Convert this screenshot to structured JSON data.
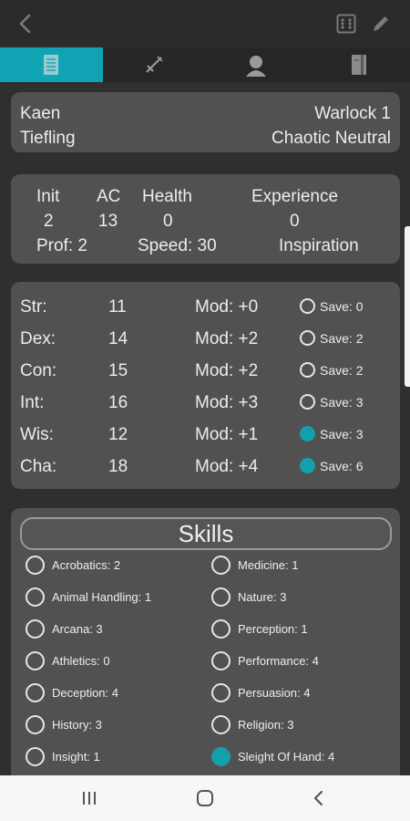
{
  "character": {
    "name": "Kaen",
    "race": "Tiefling",
    "class_level": "Warlock  1",
    "alignment": "Chaotic Neutral"
  },
  "combat": {
    "init_label": "Init",
    "init_value": "2",
    "ac_label": "AC",
    "ac_value": "13",
    "health_label": "Health",
    "health_value": "0",
    "experience_label": "Experience",
    "experience_value": "0",
    "prof": "Prof: 2",
    "speed": "Speed: 30",
    "inspiration": "Inspiration"
  },
  "abilities": [
    {
      "name": "Str:",
      "score": "11",
      "mod": "Mod: +0",
      "save": "Save: 0",
      "proficient": false
    },
    {
      "name": "Dex:",
      "score": "14",
      "mod": "Mod: +2",
      "save": "Save: 2",
      "proficient": false
    },
    {
      "name": "Con:",
      "score": "15",
      "mod": "Mod: +2",
      "save": "Save: 2",
      "proficient": false
    },
    {
      "name": "Int:",
      "score": "16",
      "mod": "Mod: +3",
      "save": "Save: 3",
      "proficient": false
    },
    {
      "name": "Wis:",
      "score": "12",
      "mod": "Mod: +1",
      "save": "Save: 3",
      "proficient": true
    },
    {
      "name": "Cha:",
      "score": "18",
      "mod": "Mod: +4",
      "save": "Save: 6",
      "proficient": true
    }
  ],
  "skills": {
    "title": "Skills",
    "left": [
      {
        "label": "Acrobatics: 2",
        "proficient": false
      },
      {
        "label": "Animal Handling: 1",
        "proficient": false
      },
      {
        "label": "Arcana: 3",
        "proficient": false
      },
      {
        "label": "Athletics: 0",
        "proficient": false
      },
      {
        "label": "Deception: 4",
        "proficient": false
      },
      {
        "label": "History: 3",
        "proficient": false
      },
      {
        "label": "Insight: 1",
        "proficient": false
      }
    ],
    "right": [
      {
        "label": "Medicine: 1",
        "proficient": false
      },
      {
        "label": "Nature: 3",
        "proficient": false
      },
      {
        "label": "Perception: 1",
        "proficient": false
      },
      {
        "label": "Performance: 4",
        "proficient": false
      },
      {
        "label": "Persuasion: 4",
        "proficient": false
      },
      {
        "label": "Religion: 3",
        "proficient": false
      },
      {
        "label": "Sleight Of Hand: 4",
        "proficient": true
      }
    ]
  },
  "colors": {
    "accent": "#0fa3b3",
    "card": "#515151",
    "background": "#2f2f2f"
  },
  "icons": {
    "back": "back-arrow-icon",
    "dice": "dice-icon",
    "edit": "pencil-icon",
    "tabs": [
      "character-sheet-icon",
      "weapons-icon",
      "profile-icon",
      "spellbook-icon"
    ],
    "nav": [
      "recent-apps-icon",
      "home-icon",
      "system-back-icon"
    ]
  }
}
